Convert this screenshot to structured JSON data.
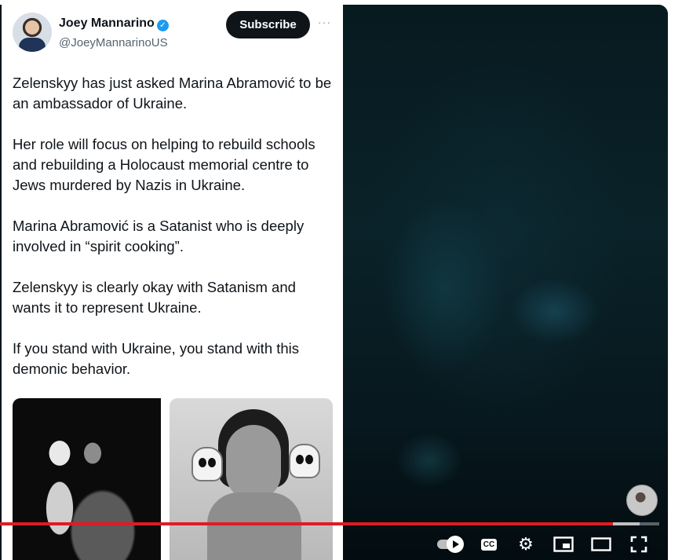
{
  "tweet": {
    "author_name": "Joey Mannarino",
    "author_handle": "@JoeyMannarinoUS",
    "subscribe_label": "Subscribe",
    "more_label": "···",
    "paragraphs": [
      "Zelenskyy has just asked Marina Abramović to be an ambassador of Ukraine.",
      "Her role will focus on helping to rebuild schools and rebuilding a Holocaust memorial centre to Jews murdered by Nazis in Ukraine.",
      "Marina Abramović is a Satanist who is deeply involved in “spirit cooking”.",
      "Zelenskyy is clearly okay with Satanism and wants it to represent Ukraine.",
      "If you stand with Ukraine, you stand with this demonic behavior."
    ]
  },
  "player": {
    "progress_fraction": 0.93,
    "buffered_fraction": 0.97,
    "cc_label": "CC",
    "icons": [
      "autoplay-toggle-icon",
      "cc-icon",
      "gear-icon",
      "miniplayer-icon",
      "theater-mode-icon",
      "fullscreen-icon"
    ],
    "accent_color": "#e01b24"
  }
}
